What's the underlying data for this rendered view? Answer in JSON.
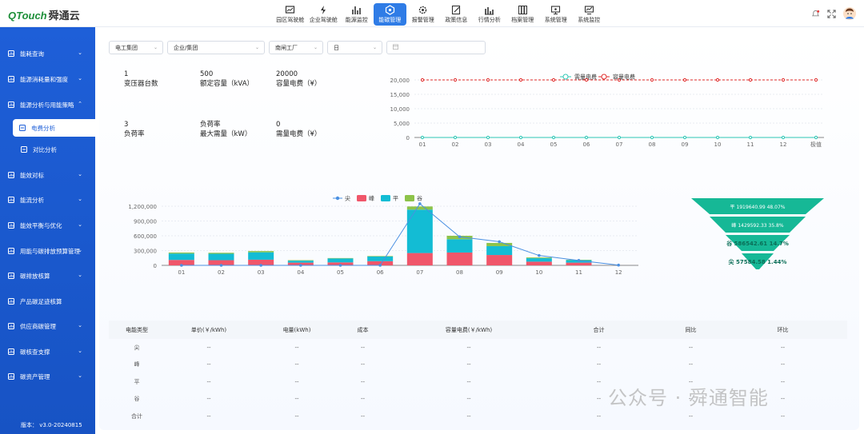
{
  "brand": {
    "logo_latin": "QTouch",
    "logo_cn": "舜通云"
  },
  "nav": [
    {
      "label": "园区驾驶舱",
      "icon": "dashboard-icon"
    },
    {
      "label": "企业驾驶舱",
      "icon": "lightning-icon"
    },
    {
      "label": "能源监控",
      "icon": "bar-chart-icon"
    },
    {
      "label": "能碳管理",
      "icon": "hexagon-icon"
    },
    {
      "label": "报警管理",
      "icon": "gear-alert-icon"
    },
    {
      "label": "政策信息",
      "icon": "edit-icon"
    },
    {
      "label": "行情分析",
      "icon": "column-chart-icon"
    },
    {
      "label": "档案管理",
      "icon": "archive-icon"
    },
    {
      "label": "系统管理",
      "icon": "monitor-icon"
    },
    {
      "label": "系统监控",
      "icon": "trend-monitor-icon"
    }
  ],
  "sidebar": {
    "items": [
      {
        "label": "能耗查询",
        "y": 22,
        "chev": "⌄"
      },
      {
        "label": "能源消耗量和强度",
        "y": 54,
        "chev": "⌄"
      },
      {
        "label": "能源分析与用能策略",
        "y": 86,
        "chev": "⌃"
      },
      {
        "label": "能效对标",
        "y": 174,
        "chev": "⌄"
      },
      {
        "label": "能流分析",
        "y": 205,
        "chev": "⌄"
      },
      {
        "label": "能效平衡与优化",
        "y": 237,
        "chev": "⌄"
      },
      {
        "label": "用能与碳排放预算管理",
        "y": 269,
        "chev": "⌄"
      },
      {
        "label": "碳排放核算",
        "y": 300,
        "chev": "⌄"
      },
      {
        "label": "产品碳足迹核算",
        "y": 332,
        "chev": ""
      },
      {
        "label": "供应商碳管理",
        "y": 363,
        "chev": "⌄"
      },
      {
        "label": "碳核查支撑",
        "y": 395,
        "chev": "⌄"
      },
      {
        "label": "碳资产管理",
        "y": 426,
        "chev": "⌄"
      }
    ],
    "subitems": [
      {
        "label": "电费分析",
        "active": true
      },
      {
        "label": "对比分析",
        "active": false
      }
    ],
    "version": "版本： v3.0-20240815"
  },
  "filters": {
    "group": "电工集团",
    "enterprise": "企业/集团",
    "factory": "南闸工厂",
    "period": "日",
    "date_placeholder": ""
  },
  "kpis": {
    "transformer_count": {
      "value": "1",
      "label": "变压器台数"
    },
    "rated_capacity": {
      "value": "500",
      "label": "额定容量（kVA）"
    },
    "capacity_fee": {
      "value": "20000",
      "label": "容量电费（¥）"
    },
    "load_rate": {
      "value": "3",
      "label": "负荷率"
    },
    "max_demand": {
      "value_label": "负荷率",
      "label": "最大需量（kW）"
    },
    "demand_fee": {
      "value": "0",
      "label": "需量电费（¥）"
    }
  },
  "line_chart": {
    "legend": [
      "需量电费",
      "容量电费"
    ],
    "categories": [
      "01",
      "02",
      "03",
      "04",
      "05",
      "06",
      "07",
      "08",
      "09",
      "10",
      "11",
      "12",
      "极值"
    ],
    "yticks": [
      "20,000",
      "15,000",
      "10,000",
      "5,000",
      "0"
    ],
    "colors": {
      "demand": "#2ec7b5",
      "capacity": "#e02a2a"
    }
  },
  "bar_chart": {
    "legend": [
      "尖",
      "峰",
      "平",
      "谷"
    ],
    "yticks": [
      "1,200,000",
      "900,000",
      "600,000",
      "300,000",
      "0"
    ],
    "categories": [
      "01",
      "02",
      "03",
      "04",
      "05",
      "06",
      "07",
      "08",
      "09",
      "10",
      "11",
      "12"
    ],
    "colors": {
      "jian": "#4a90e2",
      "feng": "#f0566a",
      "ping": "#13bcd4",
      "gu": "#8dc34a"
    }
  },
  "chart_data": [
    {
      "type": "line",
      "categories": [
        "01",
        "02",
        "03",
        "04",
        "05",
        "06",
        "07",
        "08",
        "09",
        "10",
        "11",
        "12",
        "极值"
      ],
      "series": [
        {
          "name": "需量电费",
          "values": [
            0,
            0,
            0,
            0,
            0,
            0,
            0,
            0,
            0,
            0,
            0,
            0,
            0
          ]
        },
        {
          "name": "容量电费",
          "values": [
            20000,
            20000,
            20000,
            20000,
            20000,
            20000,
            20000,
            20000,
            20000,
            20000,
            20000,
            20000,
            20000
          ]
        }
      ],
      "ylim": [
        0,
        20000
      ],
      "legend": "top-right"
    },
    {
      "type": "bar",
      "stacked": true,
      "categories": [
        "01",
        "02",
        "03",
        "04",
        "05",
        "06",
        "07",
        "08",
        "09",
        "10",
        "11",
        "12"
      ],
      "series": [
        {
          "name": "峰",
          "values": [
            110000,
            105000,
            115000,
            55000,
            60000,
            85000,
            250000,
            260000,
            210000,
            75000,
            55000,
            0
          ]
        },
        {
          "name": "平",
          "values": [
            130000,
            130000,
            150000,
            40000,
            80000,
            95000,
            880000,
            270000,
            180000,
            70000,
            50000,
            0
          ]
        },
        {
          "name": "谷",
          "values": [
            20000,
            20000,
            25000,
            10000,
            8000,
            10000,
            65000,
            70000,
            65000,
            15000,
            8000,
            0
          ]
        },
        {
          "name": "尖",
          "type": "line",
          "values": [
            0,
            0,
            0,
            0,
            0,
            0,
            1250000,
            580000,
            480000,
            200000,
            100000,
            5000
          ]
        }
      ],
      "ylim": [
        0,
        1200000
      ],
      "legend": "top"
    },
    {
      "type": "funnel",
      "segments": [
        {
          "label": "平 1919640.99 48.07%",
          "value": 48.07
        },
        {
          "label": "峰 1429592.33 35.8%",
          "value": 35.8
        },
        {
          "label": "谷 586542.61 14.7%",
          "value": 14.7
        },
        {
          "label": "尖 57584.58 1.44%",
          "value": 1.44
        }
      ]
    }
  ],
  "table": {
    "headers": [
      "电能类型",
      "单价(￥/kWh)",
      "电量(kWh)",
      "成本",
      "容量电费(￥/kWh)",
      "合计",
      "同比",
      "环比"
    ],
    "rows": [
      [
        "尖",
        "--",
        "--",
        "--",
        "--",
        "--",
        "--",
        "--"
      ],
      [
        "峰",
        "--",
        "--",
        "--",
        "--",
        "--",
        "--",
        "--"
      ],
      [
        "平",
        "--",
        "--",
        "--",
        "--",
        "--",
        "--",
        "--"
      ],
      [
        "谷",
        "--",
        "--",
        "--",
        "--",
        "--",
        "--",
        "--"
      ],
      [
        "合计",
        "--",
        "--",
        "--",
        "--",
        "--",
        "--",
        "--"
      ]
    ]
  },
  "watermark": "公众号 · 舜通智能"
}
